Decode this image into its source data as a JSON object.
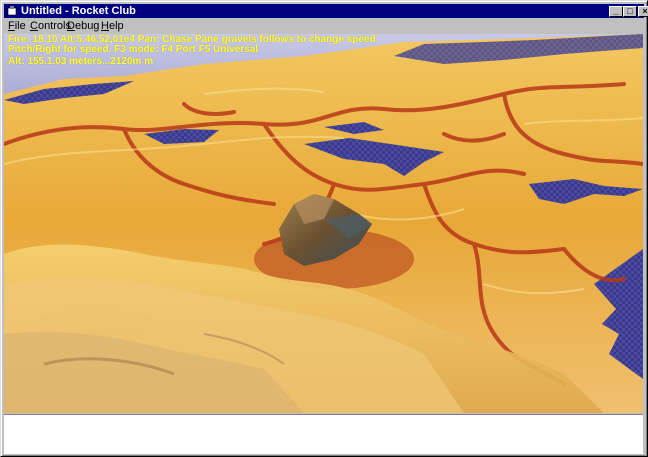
{
  "window": {
    "title": "Untitled - Rocket Club",
    "controls": {
      "minimize": "_",
      "maximize": "□",
      "close": "×"
    }
  },
  "menu": {
    "file": {
      "accel": "F",
      "rest": "ile"
    },
    "controls": {
      "accel": "C",
      "rest": "ontrols"
    },
    "debug": {
      "accel": "D",
      "rest": "ebug"
    },
    "help": {
      "accel": "H",
      "rest": "elp"
    }
  },
  "hud": {
    "line1": "Fire:      18.10   Alt:5,46,52,01e4   Pan: Chase Pane gravels follows to change speed",
    "line2": "Pitch/Right for speed.  F3 mode: F4 Port  F5 Universal",
    "line3": "Alt: 155.1.03 meters...2120m m"
  },
  "colors": {
    "titlebar": "#000080",
    "chrome": "#c0c0c0",
    "terrain_base": "#e8a838",
    "terrain_ridge": "#b83818",
    "water": "#3a3a8a",
    "hud_text": "#ffff33"
  }
}
